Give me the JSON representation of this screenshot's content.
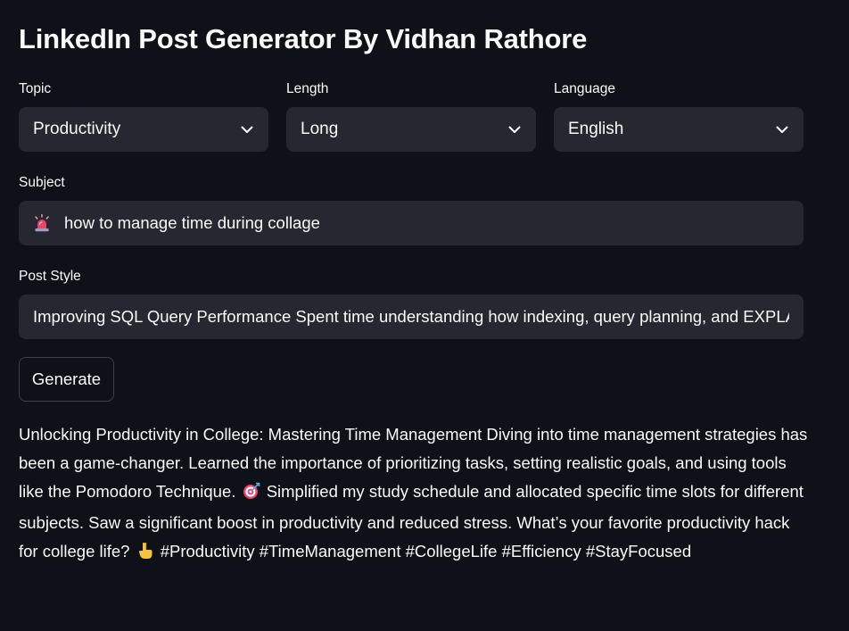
{
  "app": {
    "title": "LinkedIn Post Generator By Vidhan Rathore"
  },
  "controls": {
    "topic": {
      "label": "Topic",
      "value": "Productivity"
    },
    "length": {
      "label": "Length",
      "value": "Long"
    },
    "language": {
      "label": "Language",
      "value": "English"
    }
  },
  "subject": {
    "label": "Subject",
    "value": "how to manage time during collage",
    "icon": "siren-icon"
  },
  "post_style": {
    "label": "Post Style",
    "value": "Improving SQL Query Performance Spent time understanding how indexing, query planning, and EXPLAIN"
  },
  "generate_button": {
    "label": "Generate"
  },
  "output": {
    "part1": "Unlocking Productivity in College: Mastering Time Management Diving into time management strategies has been a game-changer. Learned the importance of prioritizing tasks, setting realistic goals, and using tools like the Pomodoro Technique.",
    "part2": "Simplified my study schedule and allocated specific time slots for different subjects. Saw a significant boost in productivity and reduced stress. What’s your favorite productivity hack for college life?",
    "part3": "#Productivity #TimeManagement #CollegeLife #Efficiency #StayFocused",
    "emoji1": "direct-hit-icon",
    "emoji2": "pointing-down-icon"
  },
  "colors": {
    "background": "#0e1117",
    "widget_background": "#262730",
    "text": "#fafafa"
  }
}
